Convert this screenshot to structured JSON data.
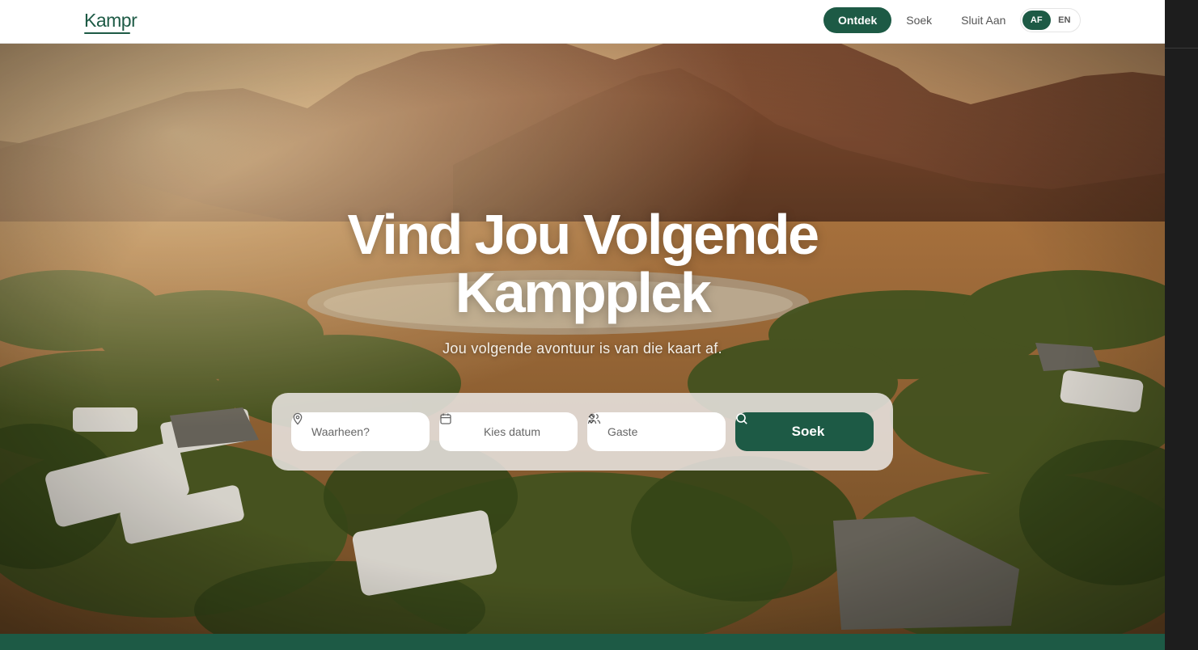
{
  "brand": {
    "logo": "Kampr",
    "color": "#1d5a45"
  },
  "nav": {
    "items": [
      {
        "label": "Ontdek",
        "active": true
      },
      {
        "label": "Soek",
        "active": false
      },
      {
        "label": "Sluit Aan",
        "active": false
      }
    ],
    "languages": [
      {
        "label": "AF",
        "active": true
      },
      {
        "label": "EN",
        "active": false
      }
    ]
  },
  "hero": {
    "title_line1": "Vind Jou Volgende",
    "title_line2": "Kampplek",
    "subtitle": "Jou volgende avontuur is van die kaart af.",
    "image_subject": "sunset-mountain-campsite"
  },
  "search": {
    "where_placeholder": "Waarheen?",
    "date_placeholder": "Kies datum",
    "guests_placeholder": "Gaste",
    "button_label": "Soek",
    "icons": [
      "location-pin-icon",
      "calendar-icon",
      "users-icon",
      "chevron-updown-icon",
      "search-icon"
    ]
  }
}
